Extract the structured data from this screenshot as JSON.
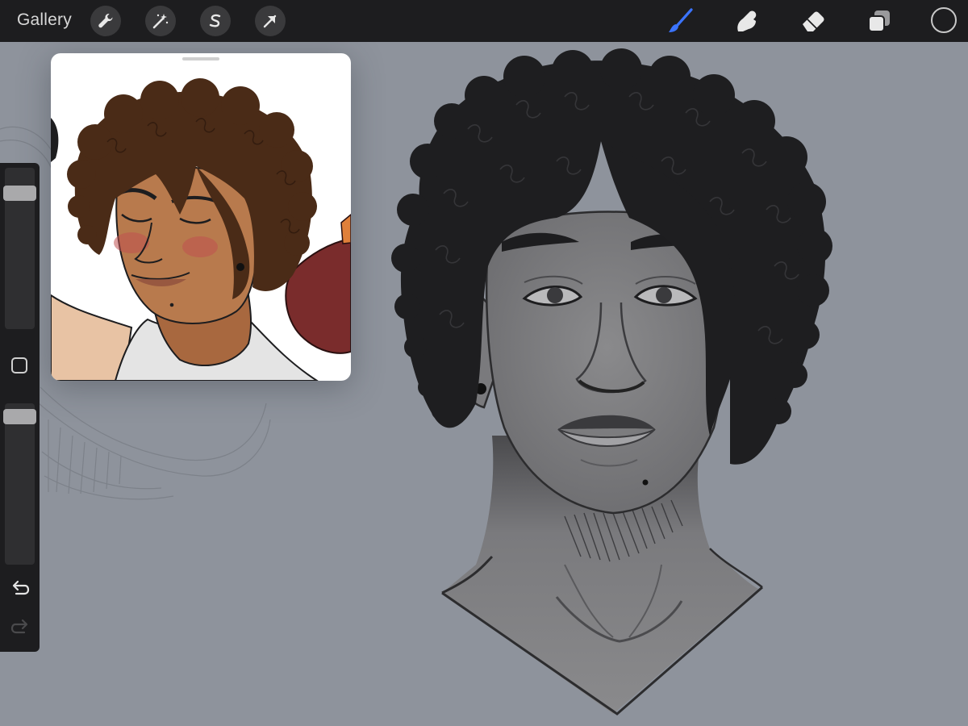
{
  "toolbar": {
    "gallery_label": "Gallery",
    "left_tools": [
      {
        "name": "actions",
        "icon": "wrench-icon"
      },
      {
        "name": "adjustments",
        "icon": "magic-wand-icon"
      },
      {
        "name": "selection",
        "icon": "selection-s-icon"
      },
      {
        "name": "transform",
        "icon": "arrow-cursor-icon"
      }
    ],
    "right_tools": [
      {
        "name": "brush",
        "icon": "brush-icon",
        "active": true
      },
      {
        "name": "smudge",
        "icon": "smudge-finger-icon",
        "active": false
      },
      {
        "name": "eraser",
        "icon": "eraser-icon",
        "active": false
      },
      {
        "name": "layers",
        "icon": "layers-icon",
        "active": false
      }
    ],
    "current_color": "#1d1d1f"
  },
  "sidebar": {
    "brush_size_level": 0.88,
    "opacity_level": 0.96,
    "modify_icon": "square-icon",
    "undo_icon": "undo-icon",
    "redo_icon": "redo-icon"
  },
  "reference_window": {
    "visible": true,
    "content": "reference-image"
  },
  "colors": {
    "canvas_background": "#8e939c",
    "toolbar_background": "#1d1d1f",
    "active_tool": "#3b74ff",
    "sketch_fill": "#7e7e80",
    "hair": "#1e1e20"
  }
}
